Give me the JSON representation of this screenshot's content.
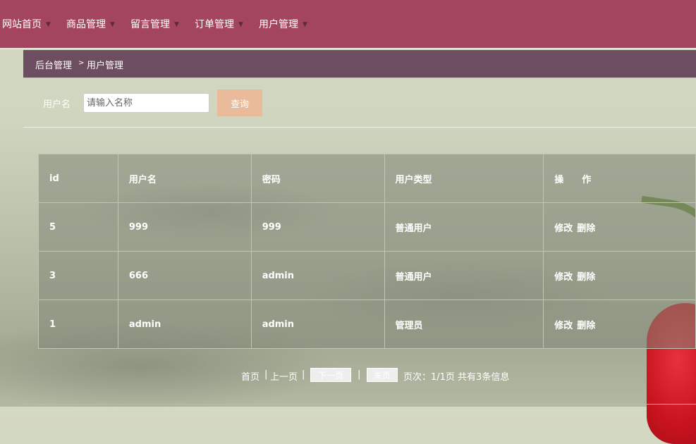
{
  "nav": {
    "items": [
      {
        "label": "网站首页"
      },
      {
        "label": "商品管理"
      },
      {
        "label": "留言管理"
      },
      {
        "label": "订单管理"
      },
      {
        "label": "用户管理"
      }
    ]
  },
  "breadcrumb": {
    "root": "后台管理",
    "separator": ">",
    "current": "用户管理"
  },
  "search": {
    "label": "用户名",
    "placeholder": "请输入名称",
    "value": "",
    "button": "查询"
  },
  "table": {
    "headers": [
      "id",
      "用户名",
      "密码",
      "用户类型",
      "操　　作"
    ],
    "rows": [
      {
        "id": "5",
        "username": "999",
        "password": "999",
        "type": "普通用户",
        "edit": "修改",
        "delete": "删除"
      },
      {
        "id": "3",
        "username": "666",
        "password": "admin",
        "type": "普通用户",
        "edit": "修改",
        "delete": "删除"
      },
      {
        "id": "1",
        "username": "admin",
        "password": "admin",
        "type": "管理员",
        "edit": "修改",
        "delete": "删除"
      }
    ]
  },
  "pager": {
    "first": "首页",
    "sep1": "|",
    "prev": "上一页",
    "sep2": "|",
    "next": "下一页",
    "sep3": "|",
    "last": "末页",
    "info": "页次：1/1页 共有3条信息"
  },
  "colors": {
    "nav_bg": "#a4455f",
    "breadcrumb_bg": "#6c4e60",
    "button_bg": "#e9bb9a"
  }
}
